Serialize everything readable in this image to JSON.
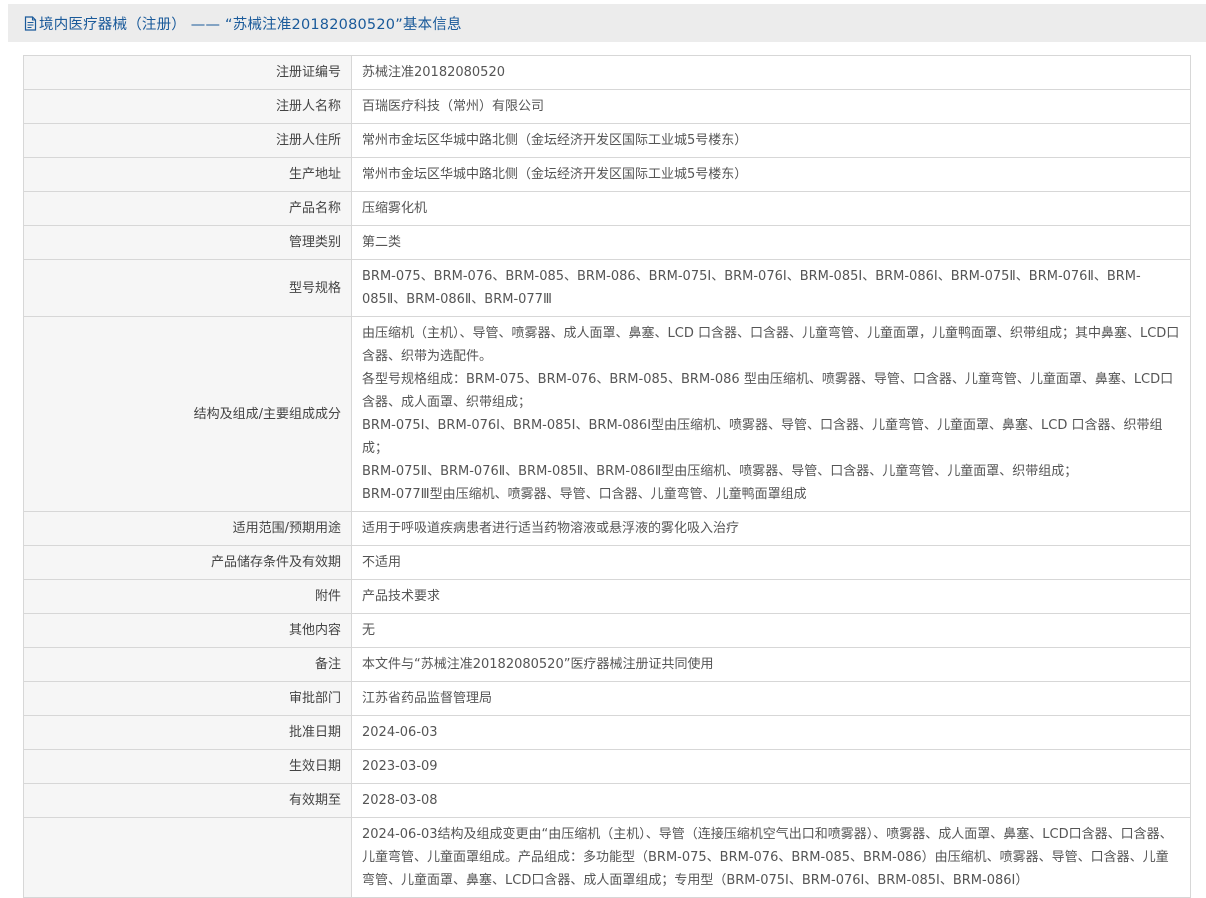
{
  "header": {
    "title": "境内医疗器械（注册） —— “苏械注准20182080520”基本信息",
    "icon": "document-icon",
    "color": "#1a5a9a"
  },
  "rows": [
    {
      "label": "注册证编号",
      "value": [
        "苏械注准20182080520"
      ]
    },
    {
      "label": "注册人名称",
      "value": [
        "百瑞医疗科技（常州）有限公司"
      ]
    },
    {
      "label": "注册人住所",
      "value": [
        "常州市金坛区华城中路北侧（金坛经济开发区国际工业城5号楼东）"
      ]
    },
    {
      "label": "生产地址",
      "value": [
        "常州市金坛区华城中路北侧（金坛经济开发区国际工业城5号楼东）"
      ]
    },
    {
      "label": "产品名称",
      "value": [
        "压缩雾化机"
      ]
    },
    {
      "label": "管理类别",
      "value": [
        "第二类"
      ]
    },
    {
      "label": "型号规格",
      "value": [
        "BRM-075、BRM-076、BRM-085、BRM-086、BRM-075Ⅰ、BRM-076Ⅰ、BRM-085Ⅰ、BRM-086Ⅰ、BRM-075Ⅱ、BRM-076Ⅱ、BRM-085Ⅱ、BRM-086Ⅱ、BRM-077Ⅲ"
      ]
    },
    {
      "label": "结构及组成/主要组成成分",
      "value": [
        "由压缩机（主机）、导管、喷雾器、成人面罩、鼻塞、LCD 口含器、口含器、儿童弯管、儿童面罩，儿童鸭面罩、织带组成；其中鼻塞、LCD口含器、织带为选配件。",
        "各型号规格组成：BRM-075、BRM-076、BRM-085、BRM-086 型由压缩机、喷雾器、导管、口含器、儿童弯管、儿童面罩、鼻塞、LCD口含器、成人面罩、织带组成；",
        "BRM-075Ⅰ、BRM-076Ⅰ、BRM-085Ⅰ、BRM-086Ⅰ型由压缩机、喷雾器、导管、口含器、儿童弯管、儿童面罩、鼻塞、LCD 口含器、织带组成；",
        "BRM-075Ⅱ、BRM-076Ⅱ、BRM-085Ⅱ、BRM-086Ⅱ型由压缩机、喷雾器、导管、口含器、儿童弯管、儿童面罩、织带组成；",
        "BRM-077Ⅲ型由压缩机、喷雾器、导管、口含器、儿童弯管、儿童鸭面罩组成"
      ]
    },
    {
      "label": "适用范围/预期用途",
      "value": [
        "适用于呼吸道疾病患者进行适当药物溶液或悬浮液的雾化吸入治疗"
      ]
    },
    {
      "label": "产品储存条件及有效期",
      "value": [
        "不适用"
      ]
    },
    {
      "label": "附件",
      "value": [
        "产品技术要求"
      ]
    },
    {
      "label": "其他内容",
      "value": [
        "无"
      ]
    },
    {
      "label": "备注",
      "value": [
        "本文件与“苏械注准20182080520”医疗器械注册证共同使用"
      ]
    },
    {
      "label": "审批部门",
      "value": [
        "江苏省药品监督管理局"
      ]
    },
    {
      "label": "批准日期",
      "value": [
        "2024-06-03"
      ]
    },
    {
      "label": "生效日期",
      "value": [
        "2023-03-09"
      ]
    },
    {
      "label": "有效期至",
      "value": [
        "2028-03-08"
      ]
    },
    {
      "label": "",
      "value": [
        "2024-06-03结构及组成变更由“由压缩机（主机）、导管（连接压缩机空气出口和喷雾器）、喷雾器、成人面罩、鼻塞、LCD口含器、口含器、儿童弯管、儿童面罩组成。产品组成：多功能型（BRM-075、BRM-076、BRM-085、BRM-086）由压缩机、喷雾器、导管、口含器、儿童弯管、儿童面罩、鼻塞、LCD口含器、成人面罩组成；专用型（BRM-075Ⅰ、BRM-076Ⅰ、BRM-085Ⅰ、BRM-086Ⅰ）"
      ]
    }
  ]
}
